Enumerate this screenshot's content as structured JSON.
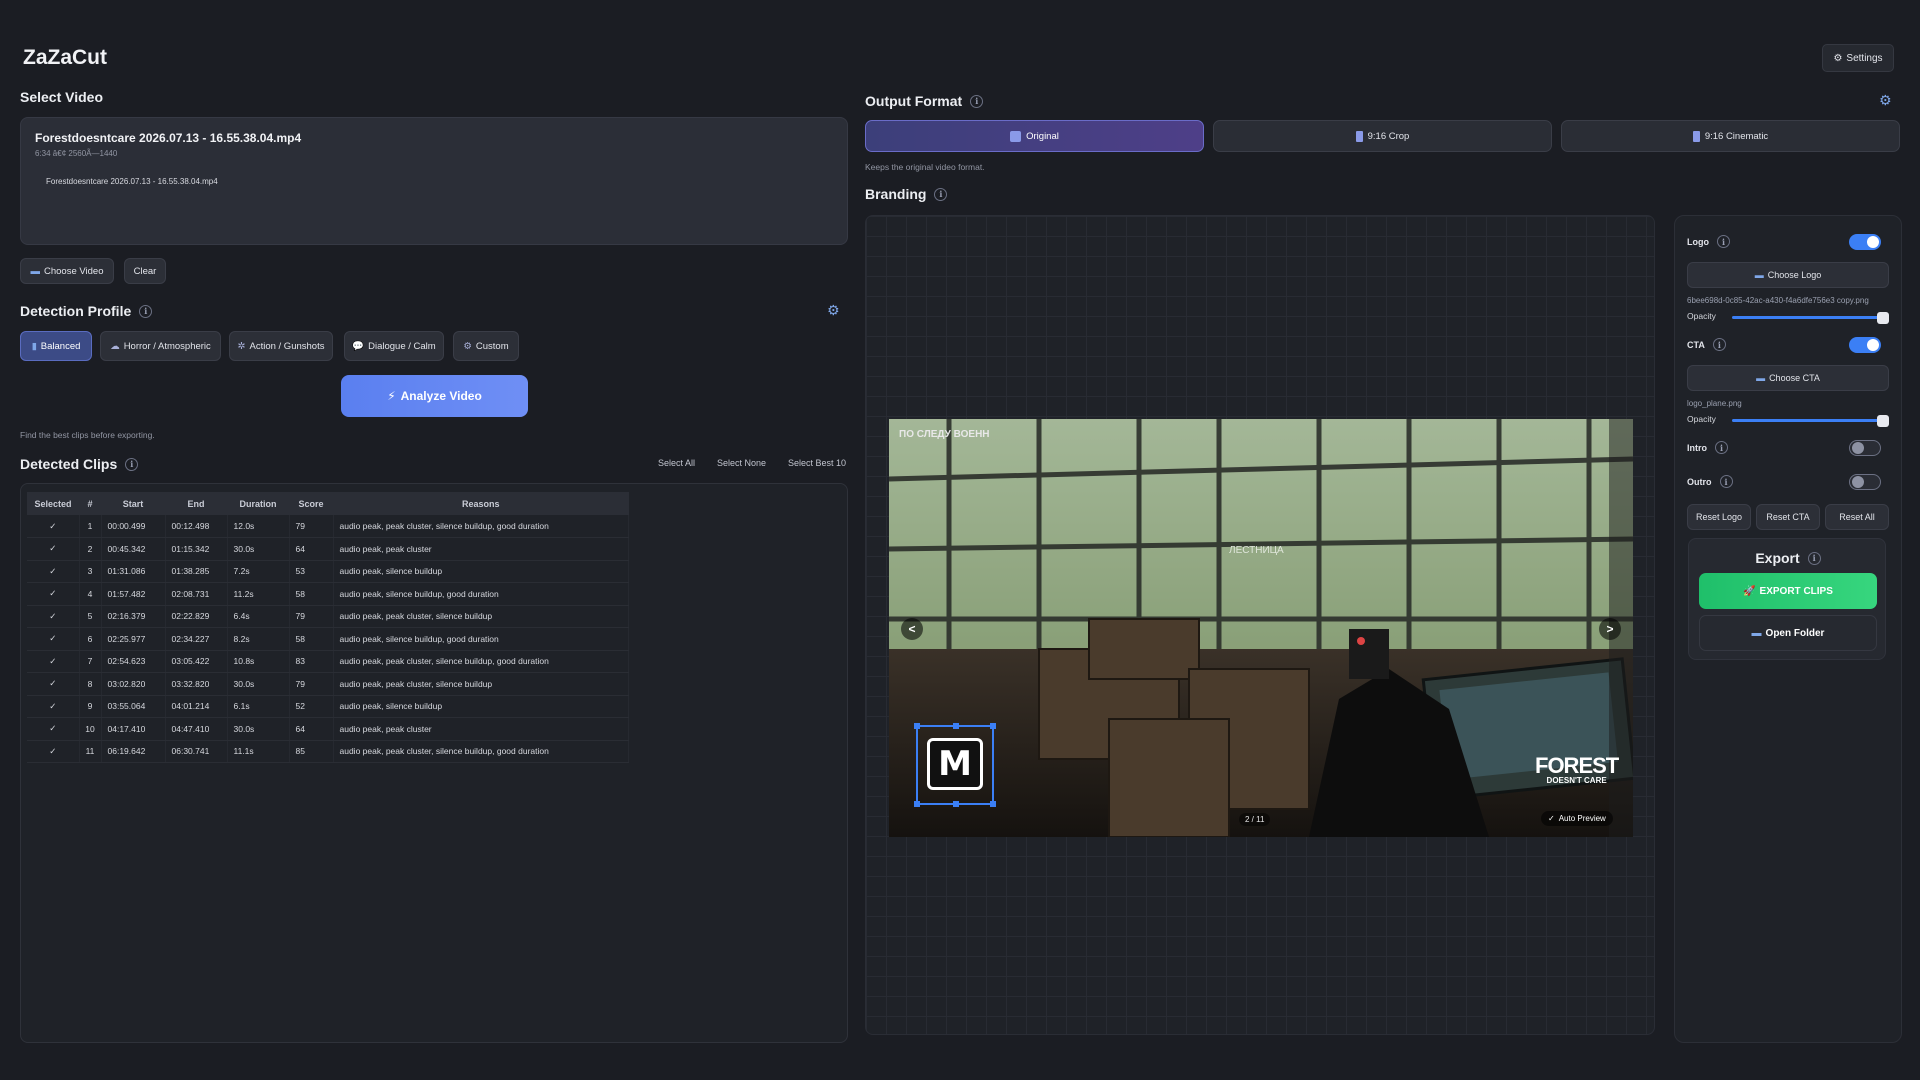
{
  "app": {
    "title": "ZaZaCut",
    "settings_label": "Settings"
  },
  "select_video": {
    "title": "Select Video",
    "file_name": "Forestdoesntcare 2026.07.13 - 16.55.38.04.mp4",
    "file_meta": "6:34 â€¢ 2560Ã—1440",
    "file_sub": "Forestdoesntcare 2026.07.13 - 16.55.38.04.mp4",
    "choose_label": "Choose Video",
    "clear_label": "Clear"
  },
  "detection": {
    "title": "Detection Profile",
    "profiles": [
      {
        "label": "Balanced",
        "icon": "bar-chart-icon"
      },
      {
        "label": "Horror / Atmospheric",
        "icon": "ghost-icon"
      },
      {
        "label": "Action / Gunshots",
        "icon": "burst-icon"
      },
      {
        "label": "Dialogue / Calm",
        "icon": "speech-icon"
      },
      {
        "label": "Custom",
        "icon": "gear-icon"
      }
    ],
    "active_profile": "Balanced",
    "analyze_label": "Analyze Video",
    "hint": "Find the best clips before exporting."
  },
  "clips": {
    "title": "Detected Clips",
    "select_all": "Select All",
    "select_none": "Select None",
    "select_best": "Select Best 10",
    "columns": [
      "Selected",
      "#",
      "Start",
      "End",
      "Duration",
      "Score",
      "Reasons"
    ],
    "rows": [
      {
        "sel": "✓",
        "n": "1",
        "start": "00:00.499",
        "end": "00:12.498",
        "dur": "12.0s",
        "score": "79",
        "reasons": "audio peak, peak cluster, silence buildup, good duration"
      },
      {
        "sel": "✓",
        "n": "2",
        "start": "00:45.342",
        "end": "01:15.342",
        "dur": "30.0s",
        "score": "64",
        "reasons": "audio peak, peak cluster"
      },
      {
        "sel": "✓",
        "n": "3",
        "start": "01:31.086",
        "end": "01:38.285",
        "dur": "7.2s",
        "score": "53",
        "reasons": "audio peak, silence buildup"
      },
      {
        "sel": "✓",
        "n": "4",
        "start": "01:57.482",
        "end": "02:08.731",
        "dur": "11.2s",
        "score": "58",
        "reasons": "audio peak, silence buildup, good duration"
      },
      {
        "sel": "✓",
        "n": "5",
        "start": "02:16.379",
        "end": "02:22.829",
        "dur": "6.4s",
        "score": "79",
        "reasons": "audio peak, peak cluster, silence buildup"
      },
      {
        "sel": "✓",
        "n": "6",
        "start": "02:25.977",
        "end": "02:34.227",
        "dur": "8.2s",
        "score": "58",
        "reasons": "audio peak, silence buildup, good duration"
      },
      {
        "sel": "✓",
        "n": "7",
        "start": "02:54.623",
        "end": "03:05.422",
        "dur": "10.8s",
        "score": "83",
        "reasons": "audio peak, peak cluster, silence buildup, good duration"
      },
      {
        "sel": "✓",
        "n": "8",
        "start": "03:02.820",
        "end": "03:32.820",
        "dur": "30.0s",
        "score": "79",
        "reasons": "audio peak, peak cluster, silence buildup"
      },
      {
        "sel": "✓",
        "n": "9",
        "start": "03:55.064",
        "end": "04:01.214",
        "dur": "6.1s",
        "score": "52",
        "reasons": "audio peak, silence buildup"
      },
      {
        "sel": "✓",
        "n": "10",
        "start": "04:17.410",
        "end": "04:47.410",
        "dur": "30.0s",
        "score": "64",
        "reasons": "audio peak, peak cluster"
      },
      {
        "sel": "✓",
        "n": "11",
        "start": "06:19.642",
        "end": "06:30.741",
        "dur": "11.1s",
        "score": "85",
        "reasons": "audio peak, peak cluster, silence buildup, good duration"
      }
    ]
  },
  "output": {
    "title": "Output Format",
    "formats": [
      "Original",
      "9:16 Crop",
      "9:16 Cinematic"
    ],
    "active_format": "Original",
    "hint": "Keeps the original video format."
  },
  "branding": {
    "title": "Branding",
    "preview_counter": "2 / 11",
    "auto_preview_label": "Auto Preview",
    "prev_label": "<",
    "next_label": ">",
    "overlay_title": "ПО СЛЕДУ ВОЕНН",
    "overlay_text": "ЛЕСТНИЦА",
    "overlay_brand_1": "FOREST",
    "overlay_brand_2": "DOESN'T CARE",
    "logo_monogram": "M"
  },
  "panel": {
    "logo": {
      "label": "Logo",
      "enabled": true,
      "choose_label": "Choose Logo",
      "file": "6bee698d-0c85-42ac-a430-f4a6dfe756e3 copy.png",
      "opacity_label": "Opacity",
      "opacity": 1.0
    },
    "cta": {
      "label": "CTA",
      "enabled": true,
      "choose_label": "Choose CTA",
      "file": "logo_plane.png",
      "opacity_label": "Opacity",
      "opacity": 1.0
    },
    "intro": {
      "label": "Intro",
      "enabled": false
    },
    "outro": {
      "label": "Outro",
      "enabled": false
    },
    "reset_logo": "Reset Logo",
    "reset_cta": "Reset CTA",
    "reset_all": "Reset All"
  },
  "export": {
    "title": "Export",
    "export_label": "EXPORT CLIPS",
    "open_folder_label": "Open Folder"
  },
  "colors": {
    "accent": "#3b7ff5",
    "export_green": "#2ccb74",
    "background": "#1b1d23"
  }
}
